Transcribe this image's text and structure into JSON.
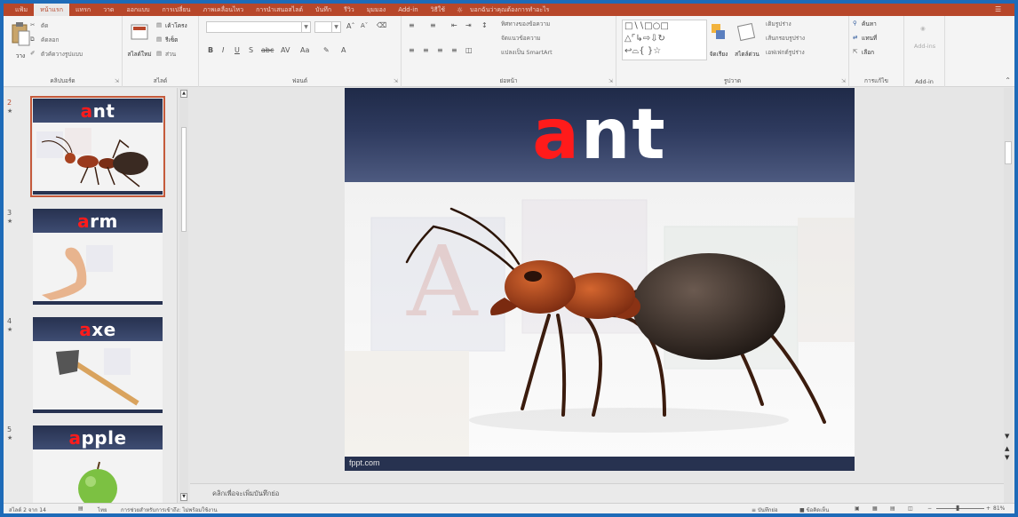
{
  "ribbon": {
    "tabs": [
      "แฟ้ม",
      "หน้าแรก",
      "แทรก",
      "วาด",
      "ออกแบบ",
      "การเปลี่ยน",
      "ภาพเคลื่อนไหว",
      "การนำเสนอสไลด์",
      "บันทึก",
      "รีวิว",
      "มุมมอง",
      "Add-in",
      "วิธีใช้"
    ],
    "active_tab": "หน้าแรก",
    "tell_me": "บอกฉันว่าคุณต้องการทำอะไร",
    "clipboard": {
      "paste": "วาง",
      "cut": "ตัด",
      "copy": "คัดลอก",
      "format_painter": "ตัวคัดวางรูปแบบ",
      "label": "คลิปบอร์ด"
    },
    "slides": {
      "new_slide": "สไลด์ใหม่",
      "layout": "เค้าโครง",
      "reset": "รีเซ็ต",
      "section": "ส่วน",
      "label": "สไลด์"
    },
    "font": {
      "label": "ฟอนต์"
    },
    "paragraph": {
      "text_direction": "ทิศทางของข้อความ",
      "align_text": "จัดแนวข้อความ",
      "smartart": "แปลงเป็น SmartArt",
      "label": "ย่อหน้า"
    },
    "drawing": {
      "arrange": "จัดเรียง",
      "quick_styles": "สไตล์ด่วน",
      "shape_fill": "เติมรูปร่าง",
      "shape_outline": "เส้นกรอบรูปร่าง",
      "shape_effects": "เอฟเฟกต์รูปร่าง",
      "label": "รูปวาด"
    },
    "editing": {
      "find": "ค้นหา",
      "replace": "แทนที่",
      "select": "เลือก",
      "label": "การแก้ไข"
    },
    "addins": {
      "button": "Add-ins",
      "label": "Add-in"
    }
  },
  "slides": [
    {
      "number": "2",
      "word_first": "a",
      "word_rest": "nt",
      "selected": true
    },
    {
      "number": "3",
      "word_first": "a",
      "word_rest": "rm",
      "selected": false
    },
    {
      "number": "4",
      "word_first": "a",
      "word_rest": "xe",
      "selected": false
    },
    {
      "number": "5",
      "word_first": "a",
      "word_rest": "pple",
      "selected": false
    }
  ],
  "current_slide": {
    "word_first": "a",
    "word_rest": "nt",
    "footer": "fppt.com"
  },
  "notes_placeholder": "คลิกเพื่อจะเพิ่มบันทึกย่อ",
  "status": {
    "slide_of": "สไลด์ 2 จาก 14",
    "language": "ไทย",
    "accessibility": "การช่วยสำหรับการเข้าถึง: ไม่พร้อมใช้งาน",
    "notes_btn": "บันทึกย่อ",
    "comments_btn": "ข้อคิดเห็น",
    "zoom": "81%"
  },
  "colors": {
    "accent": "#b7472a",
    "slide_banner": "#273250",
    "letter_red": "#ff1b1b"
  }
}
